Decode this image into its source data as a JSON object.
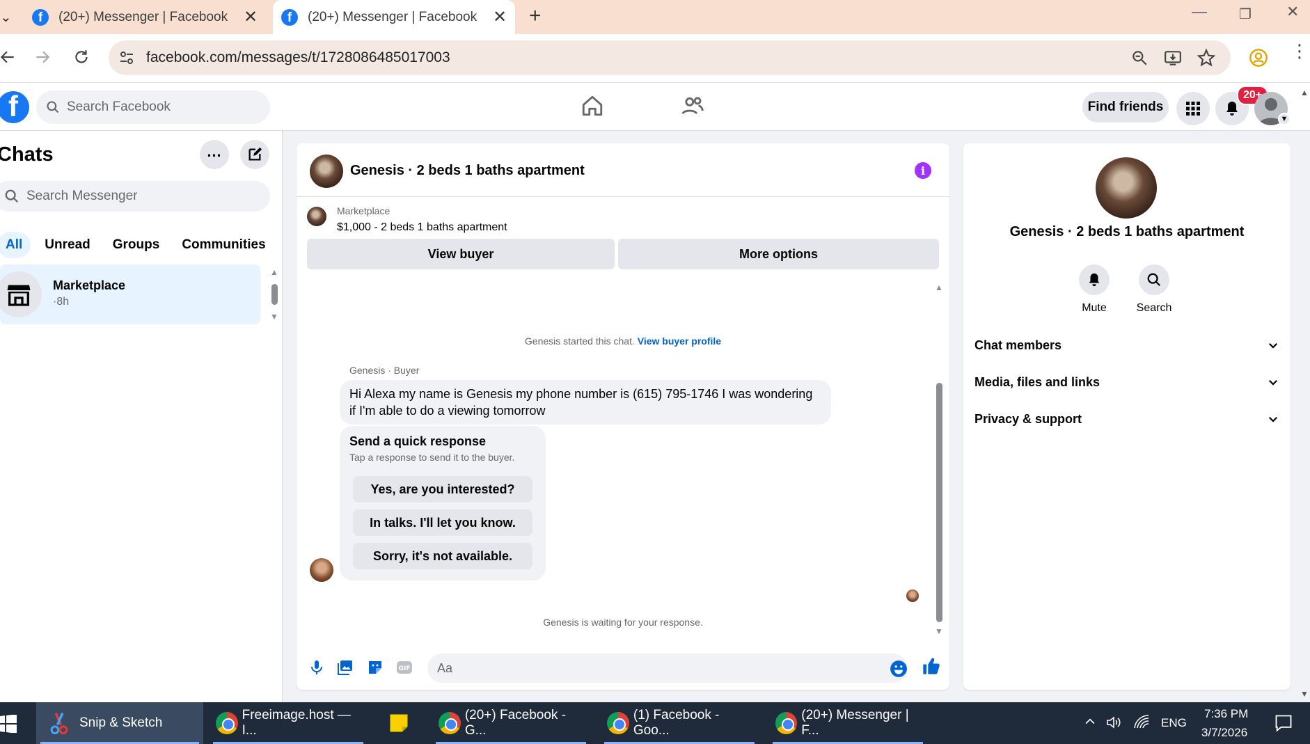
{
  "browser": {
    "tabs": [
      {
        "title": "(20+) Messenger | Facebook",
        "active": false
      },
      {
        "title": "(20+) Messenger | Facebook",
        "active": true
      }
    ],
    "url": "facebook.com/messages/t/1728086485017003"
  },
  "fb_header": {
    "search_placeholder": "Search Facebook",
    "find_friends": "Find friends",
    "notification_badge": "20+"
  },
  "sidebar": {
    "title": "Chats",
    "search_placeholder": "Search Messenger",
    "filters": [
      "All",
      "Unread",
      "Groups",
      "Communities"
    ],
    "active_filter": "All",
    "chats": [
      {
        "name": "Marketplace",
        "time": "·8h"
      }
    ]
  },
  "conversation": {
    "title": "Genesis · 2 beds 1 baths apartment",
    "marketplace_label": "Marketplace",
    "listing": "$1,000 - 2 beds 1 baths apartment",
    "view_buyer": "View buyer",
    "more_options": "More options",
    "started_text": "Genesis started this chat.",
    "view_buyer_profile": "View buyer profile",
    "sender_label": "Genesis · Buyer",
    "message": "Hi Alexa my name is Genesis my phone number is (615) 795-1746 I was wondering if I'm able to do a viewing tomorrow",
    "quick_response": {
      "title": "Send a quick response",
      "subtitle": "Tap a response to send it to the buyer.",
      "options": [
        "Yes, are you interested?",
        "In talks. I'll let you know.",
        "Sorry, it's not available."
      ]
    },
    "waiting_text": "Genesis is waiting for your response.",
    "composer_placeholder": "Aa"
  },
  "right_panel": {
    "title": "Genesis · 2 beds 1 baths apartment",
    "actions": [
      "Mute",
      "Search"
    ],
    "sections": [
      "Chat members",
      "Media, files and links",
      "Privacy & support"
    ]
  },
  "taskbar": {
    "items": [
      "Snip & Sketch",
      "Freeimage.host — I...",
      "(20+) Facebook - G...",
      "(1) Facebook - Goo...",
      "(20+) Messenger | F..."
    ],
    "lang": "ENG",
    "time": "7:36 PM",
    "date": "3/7/2026"
  },
  "colors": {
    "facebook_blue": "#1877f2",
    "accent_blue": "#0064d1",
    "info_purple": "#a033ff",
    "badge_red": "#e41e3f"
  }
}
